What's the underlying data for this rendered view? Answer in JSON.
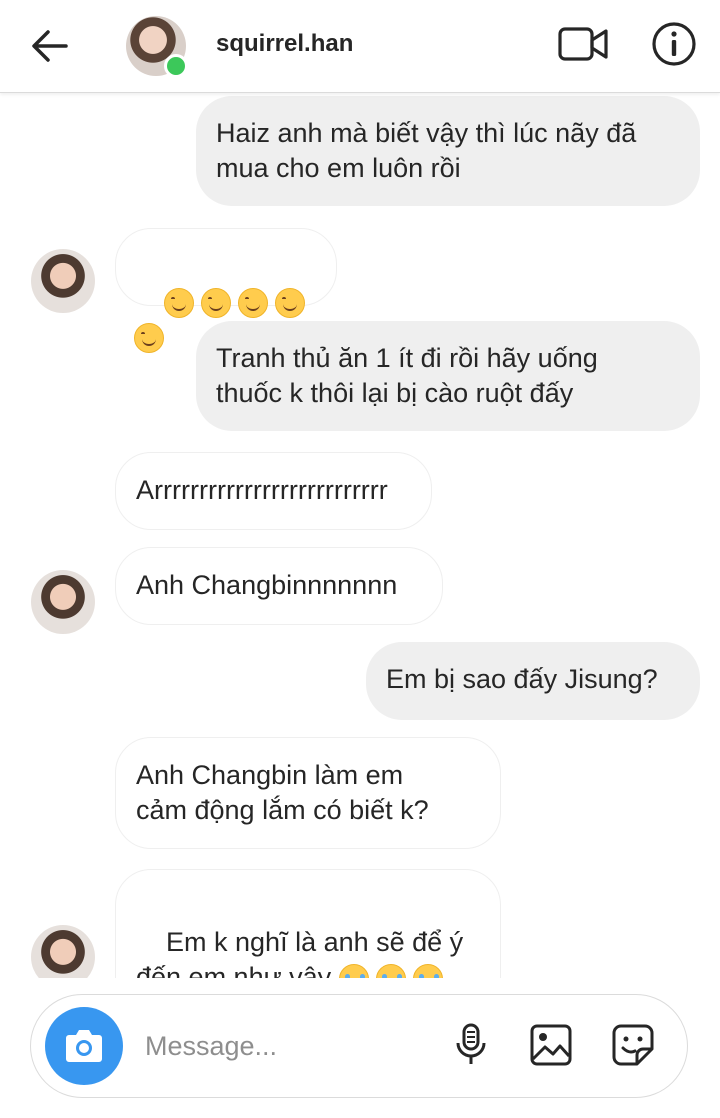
{
  "header": {
    "username": "squirrel.han",
    "online": true
  },
  "messages": [
    {
      "from": "me",
      "text": "Haiz anh mà biết vậy thì lúc nãy đã\nmua cho em luôn rồi"
    },
    {
      "from": "them",
      "emoji": [
        "smiling-face",
        "smiling-face",
        "smiling-face",
        "smiling-face",
        "smiling-face"
      ]
    },
    {
      "from": "me",
      "text": "Tranh thủ ăn 1 ít đi rồi hãy uống\nthuốc k thôi lại bị cào ruột đấy"
    },
    {
      "from": "them",
      "text": "Arrrrrrrrrrrrrrrrrrrrrrrrrr"
    },
    {
      "from": "them",
      "text": "Anh Changbinnnnnnn"
    },
    {
      "from": "me",
      "text": "Em bị sao đấy Jisung?"
    },
    {
      "from": "them",
      "text": "Anh Changbin làm em\ncảm động lắm có biết k?"
    },
    {
      "from": "them",
      "text": "Em k nghĩ là anh sẽ để ý\nđến em như vậy ",
      "emoji": [
        "crying-face",
        "crying-face",
        "crying-face"
      ]
    }
  ],
  "composer": {
    "placeholder": "Message..."
  },
  "colors": {
    "outgoing_bubble": "#efefef",
    "incoming_border": "#efefef",
    "camera_button": "#3897f0",
    "online": "#3cc85a"
  },
  "icons": [
    "back-arrow-icon",
    "video-camera-icon",
    "info-icon",
    "camera-icon",
    "microphone-icon",
    "image-icon",
    "sticker-icon"
  ]
}
